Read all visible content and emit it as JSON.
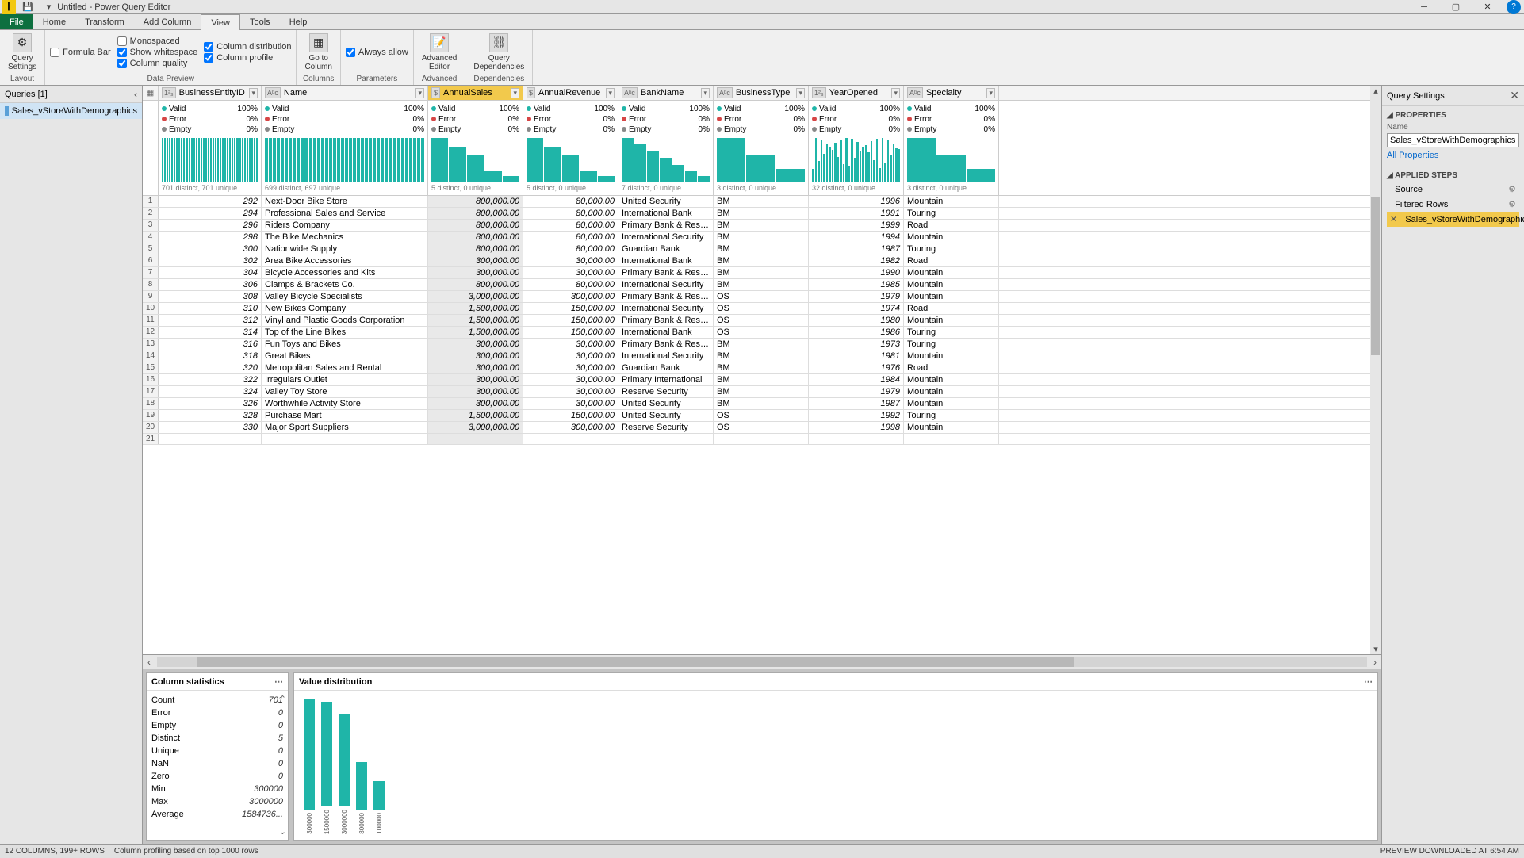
{
  "titlebar": {
    "title": "Untitled - Power Query Editor"
  },
  "menu": {
    "file": "File",
    "home": "Home",
    "transform": "Transform",
    "addcolumn": "Add Column",
    "view": "View",
    "tools": "Tools",
    "help": "Help"
  },
  "ribbon": {
    "query_settings": "Query\nSettings",
    "layout": "Layout",
    "formula_bar": "Formula Bar",
    "monospaced": "Monospaced",
    "show_whitespace": "Show whitespace",
    "column_quality": "Column quality",
    "column_distribution": "Column distribution",
    "column_profile": "Column profile",
    "data_preview": "Data Preview",
    "gotocolumn": "Go to\nColumn",
    "columns": "Columns",
    "always_allow": "Always allow",
    "parameters": "Parameters",
    "advanced_editor": "Advanced\nEditor",
    "advanced": "Advanced",
    "query_deps": "Query\nDependencies",
    "dependencies": "Dependencies"
  },
  "queries": {
    "title": "Queries [1]",
    "items": [
      "Sales_vStoreWithDemographics"
    ]
  },
  "columns": [
    {
      "name": "BusinessEntityID",
      "type": "1²₃",
      "selected": false,
      "distinct": "701 distinct, 701 unique",
      "spark": "flat"
    },
    {
      "name": "Name",
      "type": "Aᵇc",
      "selected": false,
      "distinct": "699 distinct, 697 unique",
      "spark": "flat"
    },
    {
      "name": "AnnualSales",
      "type": "$",
      "selected": true,
      "distinct": "5 distinct, 0 unique",
      "spark": "desc5"
    },
    {
      "name": "AnnualRevenue",
      "type": "$",
      "selected": false,
      "distinct": "5 distinct, 0 unique",
      "spark": "desc5"
    },
    {
      "name": "BankName",
      "type": "Aᵇc",
      "selected": false,
      "distinct": "7 distinct, 0 unique",
      "spark": "desc7"
    },
    {
      "name": "BusinessType",
      "type": "Aᵇc",
      "selected": false,
      "distinct": "3 distinct, 0 unique",
      "spark": "desc3"
    },
    {
      "name": "YearOpened",
      "type": "1²₃",
      "selected": false,
      "distinct": "32 distinct, 0 unique",
      "spark": "rand32"
    },
    {
      "name": "Specialty",
      "type": "Aᵇc",
      "selected": false,
      "distinct": "3 distinct, 0 unique",
      "spark": "desc3"
    }
  ],
  "quality": {
    "valid": "Valid",
    "valid_pct": "100%",
    "error": "Error",
    "error_pct": "0%",
    "empty": "Empty",
    "empty_pct": "0%"
  },
  "rows": [
    {
      "n": 1,
      "id": "292",
      "name": "Next-Door Bike Store",
      "sales": "800,000.00",
      "rev": "80,000.00",
      "bank": "United Security",
      "btype": "BM",
      "year": "1996",
      "spec": "Mountain"
    },
    {
      "n": 2,
      "id": "294",
      "name": "Professional Sales and Service",
      "sales": "800,000.00",
      "rev": "80,000.00",
      "bank": "International Bank",
      "btype": "BM",
      "year": "1991",
      "spec": "Touring"
    },
    {
      "n": 3,
      "id": "296",
      "name": "Riders Company",
      "sales": "800,000.00",
      "rev": "80,000.00",
      "bank": "Primary Bank & Reserve",
      "btype": "BM",
      "year": "1999",
      "spec": "Road"
    },
    {
      "n": 4,
      "id": "298",
      "name": "The Bike Mechanics",
      "sales": "800,000.00",
      "rev": "80,000.00",
      "bank": "International Security",
      "btype": "BM",
      "year": "1994",
      "spec": "Mountain"
    },
    {
      "n": 5,
      "id": "300",
      "name": "Nationwide Supply",
      "sales": "800,000.00",
      "rev": "80,000.00",
      "bank": "Guardian Bank",
      "btype": "BM",
      "year": "1987",
      "spec": "Touring"
    },
    {
      "n": 6,
      "id": "302",
      "name": "Area Bike Accessories",
      "sales": "300,000.00",
      "rev": "30,000.00",
      "bank": "International Bank",
      "btype": "BM",
      "year": "1982",
      "spec": "Road"
    },
    {
      "n": 7,
      "id": "304",
      "name": "Bicycle Accessories and Kits",
      "sales": "300,000.00",
      "rev": "30,000.00",
      "bank": "Primary Bank & Reserve",
      "btype": "BM",
      "year": "1990",
      "spec": "Mountain"
    },
    {
      "n": 8,
      "id": "306",
      "name": "Clamps & Brackets Co.",
      "sales": "800,000.00",
      "rev": "80,000.00",
      "bank": "International Security",
      "btype": "BM",
      "year": "1985",
      "spec": "Mountain"
    },
    {
      "n": 9,
      "id": "308",
      "name": "Valley Bicycle Specialists",
      "sales": "3,000,000.00",
      "rev": "300,000.00",
      "bank": "Primary Bank & Reserve",
      "btype": "OS",
      "year": "1979",
      "spec": "Mountain"
    },
    {
      "n": 10,
      "id": "310",
      "name": "New Bikes Company",
      "sales": "1,500,000.00",
      "rev": "150,000.00",
      "bank": "International Security",
      "btype": "OS",
      "year": "1974",
      "spec": "Road"
    },
    {
      "n": 11,
      "id": "312",
      "name": "Vinyl and Plastic Goods Corporation",
      "sales": "1,500,000.00",
      "rev": "150,000.00",
      "bank": "Primary Bank & Reserve",
      "btype": "OS",
      "year": "1980",
      "spec": "Mountain"
    },
    {
      "n": 12,
      "id": "314",
      "name": "Top of the Line Bikes",
      "sales": "1,500,000.00",
      "rev": "150,000.00",
      "bank": "International Bank",
      "btype": "OS",
      "year": "1986",
      "spec": "Touring"
    },
    {
      "n": 13,
      "id": "316",
      "name": "Fun Toys and Bikes",
      "sales": "300,000.00",
      "rev": "30,000.00",
      "bank": "Primary Bank & Reserve",
      "btype": "BM",
      "year": "1973",
      "spec": "Touring"
    },
    {
      "n": 14,
      "id": "318",
      "name": "Great Bikes",
      "sales": "300,000.00",
      "rev": "30,000.00",
      "bank": "International Security",
      "btype": "BM",
      "year": "1981",
      "spec": "Mountain"
    },
    {
      "n": 15,
      "id": "320",
      "name": "Metropolitan Sales and Rental",
      "sales": "300,000.00",
      "rev": "30,000.00",
      "bank": "Guardian Bank",
      "btype": "BM",
      "year": "1976",
      "spec": "Road"
    },
    {
      "n": 16,
      "id": "322",
      "name": "Irregulars Outlet",
      "sales": "300,000.00",
      "rev": "30,000.00",
      "bank": "Primary International",
      "btype": "BM",
      "year": "1984",
      "spec": "Mountain"
    },
    {
      "n": 17,
      "id": "324",
      "name": "Valley Toy Store",
      "sales": "300,000.00",
      "rev": "30,000.00",
      "bank": "Reserve Security",
      "btype": "BM",
      "year": "1979",
      "spec": "Mountain"
    },
    {
      "n": 18,
      "id": "326",
      "name": "Worthwhile Activity Store",
      "sales": "300,000.00",
      "rev": "30,000.00",
      "bank": "United Security",
      "btype": "BM",
      "year": "1987",
      "spec": "Mountain"
    },
    {
      "n": 19,
      "id": "328",
      "name": "Purchase Mart",
      "sales": "1,500,000.00",
      "rev": "150,000.00",
      "bank": "United Security",
      "btype": "OS",
      "year": "1992",
      "spec": "Touring"
    },
    {
      "n": 20,
      "id": "330",
      "name": "Major Sport Suppliers",
      "sales": "3,000,000.00",
      "rev": "300,000.00",
      "bank": "Reserve Security",
      "btype": "OS",
      "year": "1998",
      "spec": "Mountain"
    },
    {
      "n": 21,
      "id": "",
      "name": "",
      "sales": "",
      "rev": "",
      "bank": "",
      "btype": "",
      "year": "",
      "spec": ""
    }
  ],
  "colstats": {
    "title": "Column statistics",
    "rows": [
      {
        "k": "Count",
        "v": "701"
      },
      {
        "k": "Error",
        "v": "0"
      },
      {
        "k": "Empty",
        "v": "0"
      },
      {
        "k": "Distinct",
        "v": "5"
      },
      {
        "k": "Unique",
        "v": "0"
      },
      {
        "k": "NaN",
        "v": "0"
      },
      {
        "k": "Zero",
        "v": "0"
      },
      {
        "k": "Min",
        "v": "300000"
      },
      {
        "k": "Max",
        "v": "3000000"
      },
      {
        "k": "Average",
        "v": "1584736..."
      }
    ]
  },
  "valuedist": {
    "title": "Value distribution"
  },
  "chart_data": {
    "type": "bar",
    "categories": [
      "300000",
      "1500000",
      "3000000",
      "800000",
      "100000"
    ],
    "values": [
      175,
      165,
      145,
      75,
      45
    ],
    "title": "Value distribution",
    "xlabel": "",
    "ylabel": "",
    "ylim": [
      0,
      180
    ]
  },
  "settings": {
    "title": "Query Settings",
    "properties": "PROPERTIES",
    "name_lbl": "Name",
    "name_val": "Sales_vStoreWithDemographics",
    "all_props": "All Properties",
    "applied": "APPLIED STEPS",
    "steps": [
      {
        "name": "Source",
        "gear": true,
        "sel": false
      },
      {
        "name": "Filtered Rows",
        "gear": true,
        "sel": false
      },
      {
        "name": "Sales_vStoreWithDemographics",
        "gear": false,
        "sel": true
      }
    ]
  },
  "status": {
    "left1": "12 COLUMNS, 199+ ROWS",
    "left2": "Column profiling based on top 1000 rows",
    "right": "PREVIEW DOWNLOADED AT 6:54 AM"
  }
}
